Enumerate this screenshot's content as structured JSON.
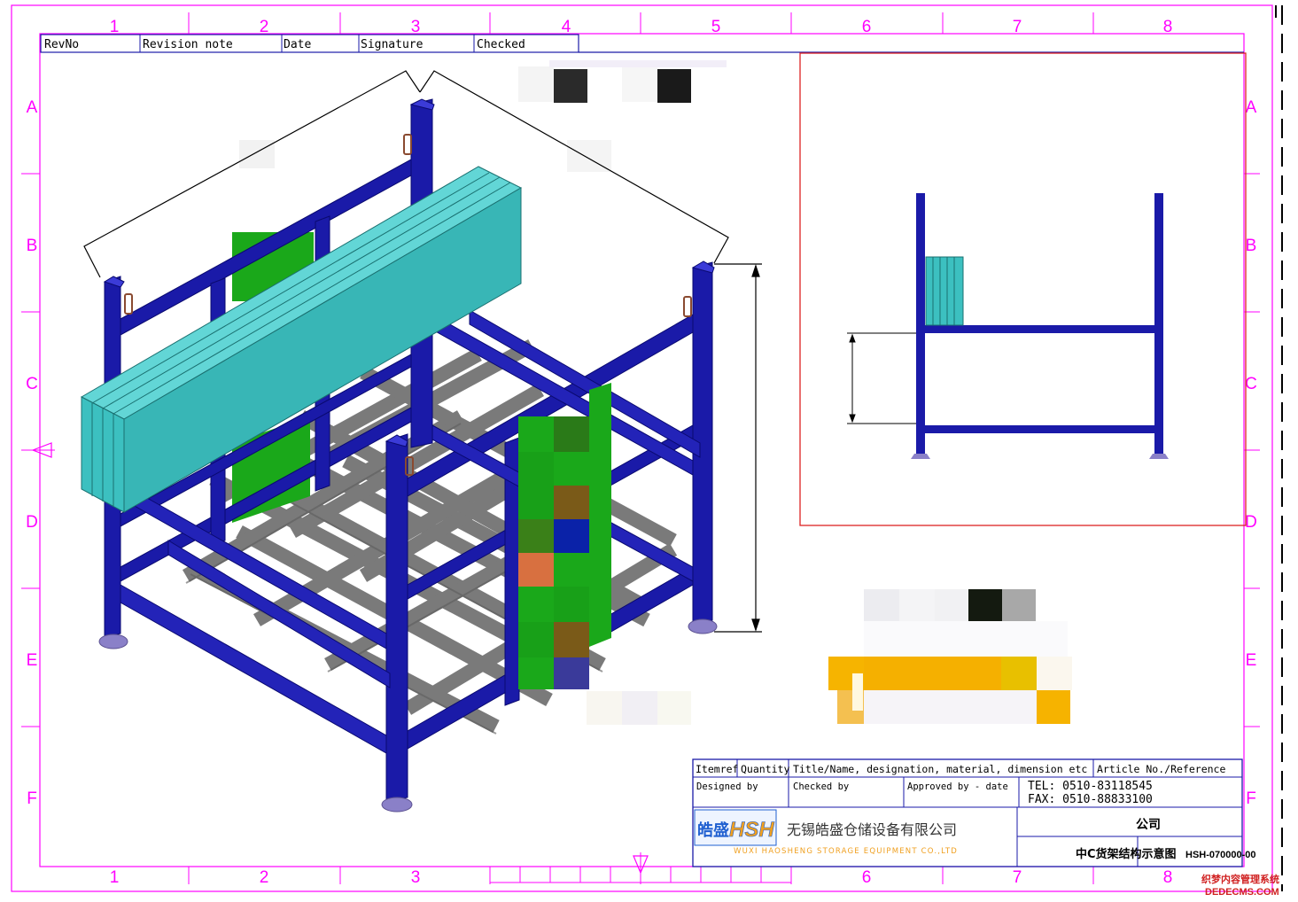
{
  "revision_table": {
    "headers": [
      "RevNo",
      "Revision note",
      "Date",
      "Signature",
      "Checked"
    ]
  },
  "zone_markers": {
    "columns": [
      "1",
      "2",
      "3",
      "4",
      "5",
      "6",
      "7",
      "8"
    ],
    "rows": [
      "A",
      "B",
      "C",
      "D",
      "E",
      "F"
    ]
  },
  "title_block": {
    "headers": {
      "itemref": "Itemref",
      "quantity": "Quantity",
      "title": "Title/Name, designation, material, dimension etc",
      "article": "Article No./Reference"
    },
    "designed_by": "Designed by",
    "checked_by": "Checked by",
    "approved_by": "Approved by - date",
    "tel": "TEL: 0510-83118545",
    "fax": "FAX: 0510-88833100",
    "logo_cn": "皓盛",
    "logo_en": "HSH",
    "company_cn": "无锡皓盛仓储设备有限公司",
    "company_en": "WUXI HAOSHENG STORAGE EQUIPMENT CO.,LTD",
    "client": "公司",
    "drawing_title": "中C货架结构示意图",
    "drawing_no": "HSH-070000-00"
  },
  "watermark": {
    "cn": "织梦内容管理系统",
    "en": "DEDECMS.COM"
  },
  "colors": {
    "frame_blue": "#1a1aa8",
    "frame_blue_light": "#3b3bd8",
    "crossbar_gray": "#8a8a8a",
    "cargo_teal": "#3cc0c0",
    "panel_green": "#1aa81a",
    "border_magenta": "#ff00ff",
    "side_view_red": "#dd2222",
    "foot_purple": "#8a80c8",
    "logo_blue": "#1f5fd0",
    "logo_orange": "#f0a020"
  }
}
